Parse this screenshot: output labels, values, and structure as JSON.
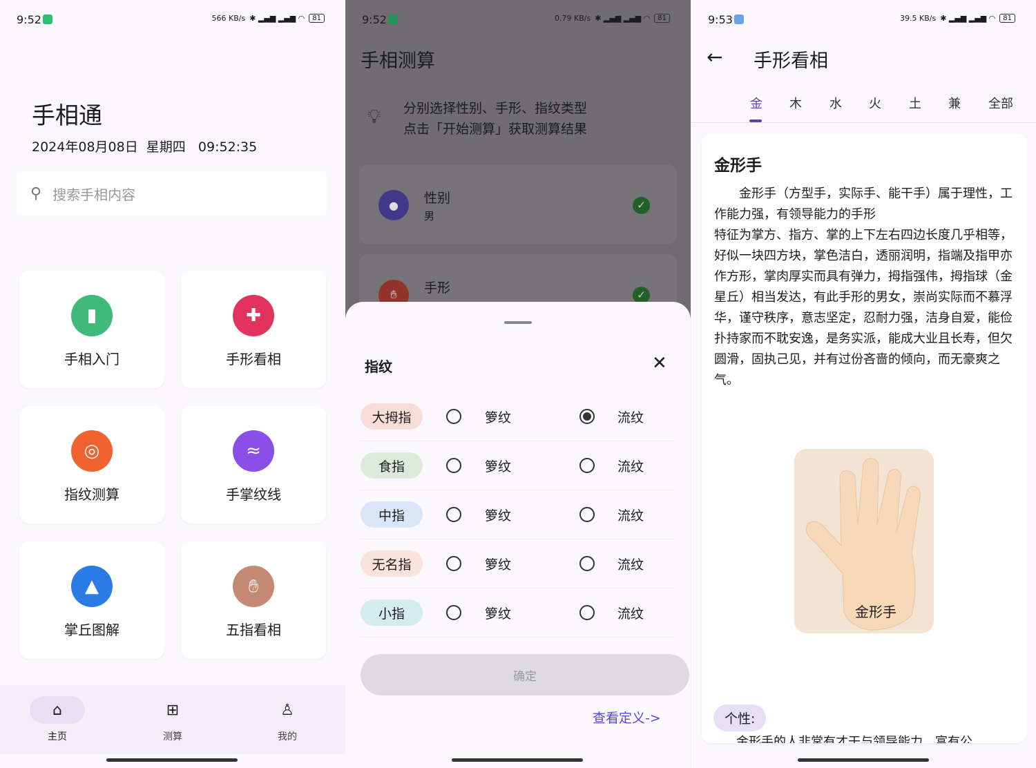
{
  "home": {
    "status": {
      "time": "9:52",
      "speed": "566 KB/s",
      "battery": "81"
    },
    "app_title": "手相通",
    "datetime": "2024年08月08日  星期四   09:52:35",
    "search_placeholder": "搜索手相内容",
    "tiles": [
      {
        "label": "手相入门",
        "icon": "book-icon",
        "color": "#3fba78"
      },
      {
        "label": "手形看相",
        "icon": "hand-grid-icon",
        "color": "#e2335f"
      },
      {
        "label": "指纹测算",
        "icon": "fingerprint-icon",
        "color": "#f0622f"
      },
      {
        "label": "手掌纹线",
        "icon": "palm-lines-icon",
        "color": "#8a4fe6"
      },
      {
        "label": "掌丘图解",
        "icon": "mountain-icon",
        "color": "#2a7be4"
      },
      {
        "label": "五指看相",
        "icon": "hand-icon",
        "color": "#c58a74"
      }
    ],
    "nav": [
      {
        "label": "主页",
        "icon": "home-icon",
        "active": true
      },
      {
        "label": "测算",
        "icon": "calculator-icon"
      },
      {
        "label": "我的",
        "icon": "person-icon"
      }
    ]
  },
  "calc": {
    "status": {
      "time": "9:52",
      "speed": "0.79 KB/s",
      "battery": "81"
    },
    "title": "手相测算",
    "hint_lines": [
      "分别选择性别、手形、指纹类型",
      "点击「开始测算」获取测算结果"
    ],
    "items": [
      {
        "title": "性别",
        "value": "男"
      },
      {
        "title": "手形",
        "value": ""
      }
    ],
    "sheet": {
      "title": "指纹",
      "option_a": "箩纹",
      "option_b": "流纹",
      "fingers": [
        {
          "name": "大拇指",
          "color": "#f7dcd8",
          "selected": "b"
        },
        {
          "name": "食指",
          "color": "#dde9db",
          "selected": null
        },
        {
          "name": "中指",
          "color": "#dae6f8",
          "selected": null
        },
        {
          "name": "无名指",
          "color": "#fae2dc",
          "selected": null
        },
        {
          "name": "小指",
          "color": "#d5ecec",
          "selected": null
        }
      ],
      "confirm": "确定",
      "link": "查看定义->"
    }
  },
  "shape": {
    "status": {
      "time": "9:53",
      "speed": "39.5 KB/s",
      "battery": "81"
    },
    "title": "手形看相",
    "tabs": [
      "金",
      "木",
      "水",
      "火",
      "土",
      "兼",
      "全部"
    ],
    "active_tab": 0,
    "card_title": "金形手",
    "paragraph1": "金形手（方型手，实际手、能干手）属于理性，工作能力强，有领导能力的手形",
    "paragraph2": "特征为掌方、指方、掌的上下左右四边长度几乎相等，好似一块四方块，掌色洁白，透丽润明，指端及指甲亦作方形，掌肉厚实而具有弹力，拇指强伟，拇指球（金星丘）相当发达，有此手形的男女，崇尚实际而不慕浮华，谨守秩序，意志坚定，忍耐力强，洁身自爱，能俭扑持家而不耽安逸，是务实派，能成大业且长寿，但欠圆滑，固执己见，并有过份吝啬的倾向，而无豪爽之气。",
    "image_caption": "金形手",
    "section_label": "个性:",
    "section_text": "金形手的人非常有才干与领导能力，富有公"
  }
}
